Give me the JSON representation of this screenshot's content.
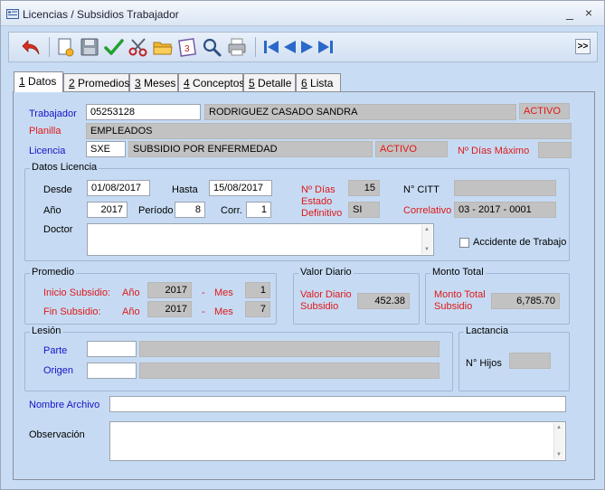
{
  "window": {
    "title": "Licencias / Subsidios Trabajador",
    "minimize": "_",
    "close": "×"
  },
  "toolbar": {
    "icons": [
      "undo-icon",
      "new-document-icon",
      "save-icon",
      "check-icon",
      "cut-icon",
      "open-folder-icon",
      "calendar-icon",
      "search-icon",
      "print-icon",
      "first-record-icon",
      "previous-record-icon",
      "next-record-icon",
      "last-record-icon"
    ],
    "more_label": ">>"
  },
  "tabs": [
    {
      "key": "1",
      "label": " Datos"
    },
    {
      "key": "2",
      "label": " Promedios"
    },
    {
      "key": "3",
      "label": " Meses"
    },
    {
      "key": "4",
      "label": " Conceptos"
    },
    {
      "key": "5",
      "label": " Detalle"
    },
    {
      "key": "6",
      "label": " Lista"
    }
  ],
  "header": {
    "trabajador_label": "Trabajador",
    "trabajador_code": "05253128",
    "trabajador_name": "RODRIGUEZ CASADO SANDRA",
    "trabajador_status": "ACTIVO",
    "planilla_label": "Planilla",
    "planilla_value": "EMPLEADOS",
    "licencia_label": "Licencia",
    "licencia_code": "SXE",
    "licencia_desc": "SUBSIDIO POR ENFERMEDAD",
    "licencia_status": "ACTIVO",
    "max_dias_label": "Nº Días Máximo",
    "max_dias_value": ""
  },
  "datos_licencia": {
    "title": "Datos Licencia",
    "desde_label": "Desde",
    "desde_value": "01/08/2017",
    "hasta_label": "Hasta",
    "hasta_value": "15/08/2017",
    "n_dias_label": "Nº Días",
    "n_dias_value": "15",
    "citt_label": "N° CITT",
    "citt_value": "",
    "anio_label": "Año",
    "anio_value": "2017",
    "periodo_label": "Período",
    "periodo_value": "8",
    "corr_label": "Corr.",
    "corr_value": "1",
    "estado_label_1": "Estado",
    "estado_label_2": "Definitivo",
    "estado_value": "SI",
    "correlativo_label": "Correlativo",
    "correlativo_value": "03 - 2017 - 0001",
    "doctor_label": "Doctor",
    "doctor_value": "",
    "accidente_label": "Accidente de Trabajo",
    "accidente_checked": false
  },
  "promedio": {
    "title": "Promedio",
    "inicio_label": "Inicio Subsidio:",
    "fin_label": "Fin Subsidio:",
    "anio_label": "Año",
    "mes_label": "Mes",
    "dash": "-",
    "inicio_anio": "2017",
    "inicio_mes": "1",
    "fin_anio": "2017",
    "fin_mes": "7"
  },
  "valor_diario": {
    "title": "Valor Diario",
    "label_1": "Valor Diario",
    "label_2": "Subsidio",
    "value": "452.38"
  },
  "monto_total": {
    "title": "Monto Total",
    "label_1": "Monto Total",
    "label_2": "Subsidio",
    "value": "6,785.70"
  },
  "lesion": {
    "title": "Lesión",
    "parte_label": "Parte",
    "parte_code": "",
    "parte_desc": "",
    "origen_label": "Origen",
    "origen_code": "",
    "origen_desc": ""
  },
  "lactancia": {
    "title": "Lactancia",
    "hijos_label": "N° Hijos",
    "hijos_value": ""
  },
  "archivo": {
    "label": "Nombre Archivo",
    "value": ""
  },
  "observacion": {
    "label": "Observación",
    "value": ""
  },
  "colors": {
    "label_blue": "#1414c8",
    "label_red": "#e01818",
    "panel_bg": "#c6dbf3",
    "readonly_bg": "#c2c2c2"
  }
}
